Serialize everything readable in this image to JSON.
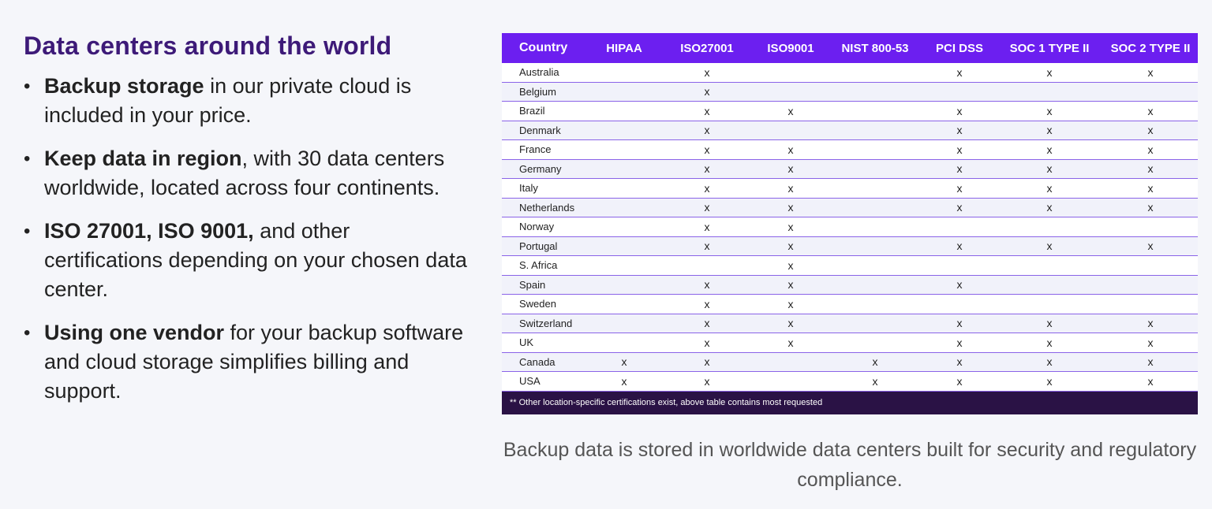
{
  "left": {
    "heading": "Data centers around the world",
    "bullets": [
      {
        "bold": "Backup storage",
        "rest": " in our private cloud is included in your price."
      },
      {
        "bold": "Keep data in region",
        "rest": ", with 30 data centers worldwide, located across four continents."
      },
      {
        "bold": "ISO 27001, ISO 9001,",
        "rest": " and other certifications depending on your chosen data center."
      },
      {
        "bold": "Using one vendor",
        "rest": " for your backup software and cloud storage simplifies billing and support."
      }
    ]
  },
  "table": {
    "headers": [
      "Country",
      "HIPAA",
      "ISO27001",
      "ISO9001",
      "NIST 800-53",
      "PCI DSS",
      "SOC 1 TYPE II",
      "SOC 2 TYPE II"
    ],
    "rows": [
      [
        "Australia",
        "",
        "x",
        "",
        "",
        "x",
        "x",
        "x"
      ],
      [
        "Belgium",
        "",
        "x",
        "",
        "",
        "",
        "",
        ""
      ],
      [
        "Brazil",
        "",
        "x",
        "x",
        "",
        "x",
        "x",
        "x"
      ],
      [
        "Denmark",
        "",
        "x",
        "",
        "",
        "x",
        "x",
        "x"
      ],
      [
        "France",
        "",
        "x",
        "x",
        "",
        "x",
        "x",
        "x"
      ],
      [
        "Germany",
        "",
        "x",
        "x",
        "",
        "x",
        "x",
        "x"
      ],
      [
        "Italy",
        "",
        "x",
        "x",
        "",
        "x",
        "x",
        "x"
      ],
      [
        "Netherlands",
        "",
        "x",
        "x",
        "",
        "x",
        "x",
        "x"
      ],
      [
        "Norway",
        "",
        "x",
        "x",
        "",
        "",
        "",
        ""
      ],
      [
        "Portugal",
        "",
        "x",
        "x",
        "",
        "x",
        "x",
        "x"
      ],
      [
        "S. Africa",
        "",
        "",
        "x",
        "",
        "",
        "",
        ""
      ],
      [
        "Spain",
        "",
        "x",
        "x",
        "",
        "x",
        "",
        ""
      ],
      [
        "Sweden",
        "",
        "x",
        "x",
        "",
        "",
        "",
        ""
      ],
      [
        "Switzerland",
        "",
        "x",
        "x",
        "",
        "x",
        "x",
        "x"
      ],
      [
        "UK",
        "",
        "x",
        "x",
        "",
        "x",
        "x",
        "x"
      ],
      [
        "Canada",
        "x",
        "x",
        "",
        "x",
        "x",
        "x",
        "x"
      ],
      [
        "USA",
        "x",
        "x",
        "",
        "x",
        "x",
        "x",
        "x"
      ]
    ],
    "footnote": "** Other location-specific certifications exist, above table contains most requested"
  },
  "caption": "Backup data is stored in worldwide data centers built for security and regulatory compliance.",
  "colors": {
    "heading": "#3d1a78",
    "header_bg": "#6c1ff0",
    "footnote_bg": "#2a1245",
    "row_border": "#8a63e8"
  }
}
